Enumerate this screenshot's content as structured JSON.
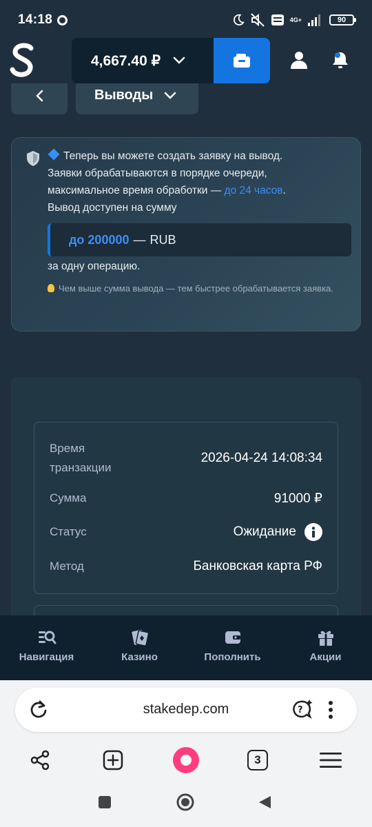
{
  "status_bar": {
    "time": "14:18",
    "network_label_top": "4G+",
    "battery": "90"
  },
  "header": {
    "logo_letter": "S",
    "balance": "4,667.40 ₽",
    "icons": [
      "wallet-icon",
      "user-icon",
      "bell-icon"
    ]
  },
  "section": {
    "back_icon": "chevron-left-icon",
    "title": "Выводы"
  },
  "notice": {
    "line1": "Теперь вы можете создать заявку на вывод.",
    "line2": "Заявки обрабатываются в порядке очереди,",
    "line3_prefix": "максимальное время обработки — ",
    "line3_link": "до 24 часов",
    "line3_suffix": ".",
    "line4": "Вывод доступен на сумму",
    "limit_value": "до 200000",
    "limit_dash": "—",
    "limit_currency": "RUB",
    "per_operation": "за одну операцию.",
    "tip": "Чем выше сумма вывода — тем быстрее обрабатывается заявка."
  },
  "transaction": {
    "time_label": "Время транзакции",
    "time_value": "2026-04-24 14:08:34",
    "amount_label": "Сумма",
    "amount_value": "91000 ₽",
    "status_label": "Статус",
    "status_value": "Ожидание",
    "method_label": "Метод",
    "method_value": "Банковская карта РФ"
  },
  "bottom_nav": {
    "items": [
      {
        "label": "Навигация",
        "icon": "search-list-icon"
      },
      {
        "label": "Казино",
        "icon": "cards-icon"
      },
      {
        "label": "Пополнить",
        "icon": "wallet-icon"
      },
      {
        "label": "Акции",
        "icon": "gift-icon"
      }
    ]
  },
  "browser": {
    "url": "stakedep.com",
    "tab_count": "3"
  },
  "colors": {
    "background": "#1f2f3d",
    "accent_blue": "#1475e1",
    "link_blue": "#3a8ef6",
    "nav_bg": "#0f212e"
  }
}
